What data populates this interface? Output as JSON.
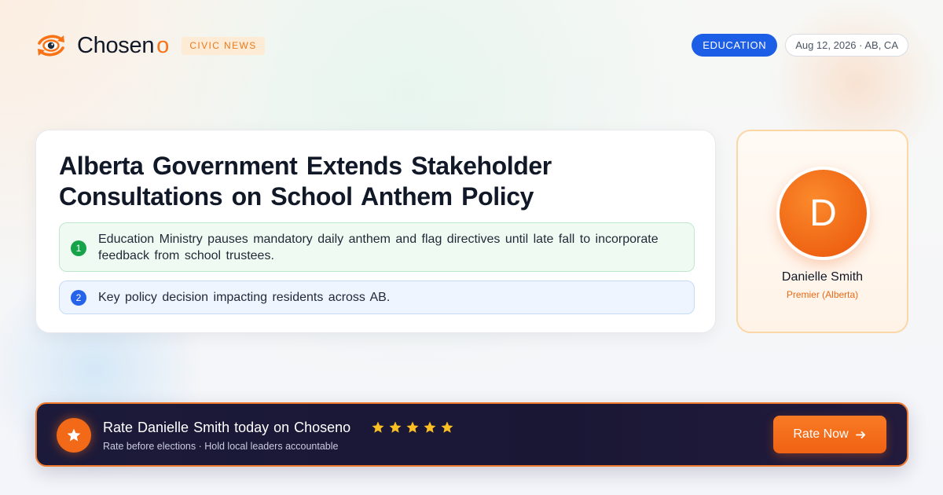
{
  "brand": {
    "name": "Chosen",
    "name_suffix": "o",
    "tag": "CIVIC NEWS",
    "logo_icon": "eye-refresh-icon",
    "accent_color": "#f97316"
  },
  "header": {
    "category": "EDUCATION",
    "date_location": "Aug 12, 2026 · AB, CA",
    "category_color": "#1d5ee6"
  },
  "article": {
    "headline": "Alberta Government Extends Stakeholder Consultations on School Anthem Policy",
    "points": [
      {
        "number": "1",
        "text": "Education Ministry pauses mandatory daily anthem and flag directives until late fall to incorporate feedback from school trustees.",
        "color": "#16a34a"
      },
      {
        "number": "2",
        "text": "Key policy decision impacting residents across AB.",
        "color": "#2563eb"
      }
    ]
  },
  "profile": {
    "initial": "D",
    "name": "Danielle Smith",
    "role": "Premier (Alberta)"
  },
  "cta": {
    "icon": "star-icon",
    "title": "Rate Danielle Smith today on Choseno",
    "stars": 5,
    "subtitle": "Rate before elections · Hold local leaders accountable",
    "button_label": "Rate Now",
    "button_icon": "arrow-right-icon"
  }
}
